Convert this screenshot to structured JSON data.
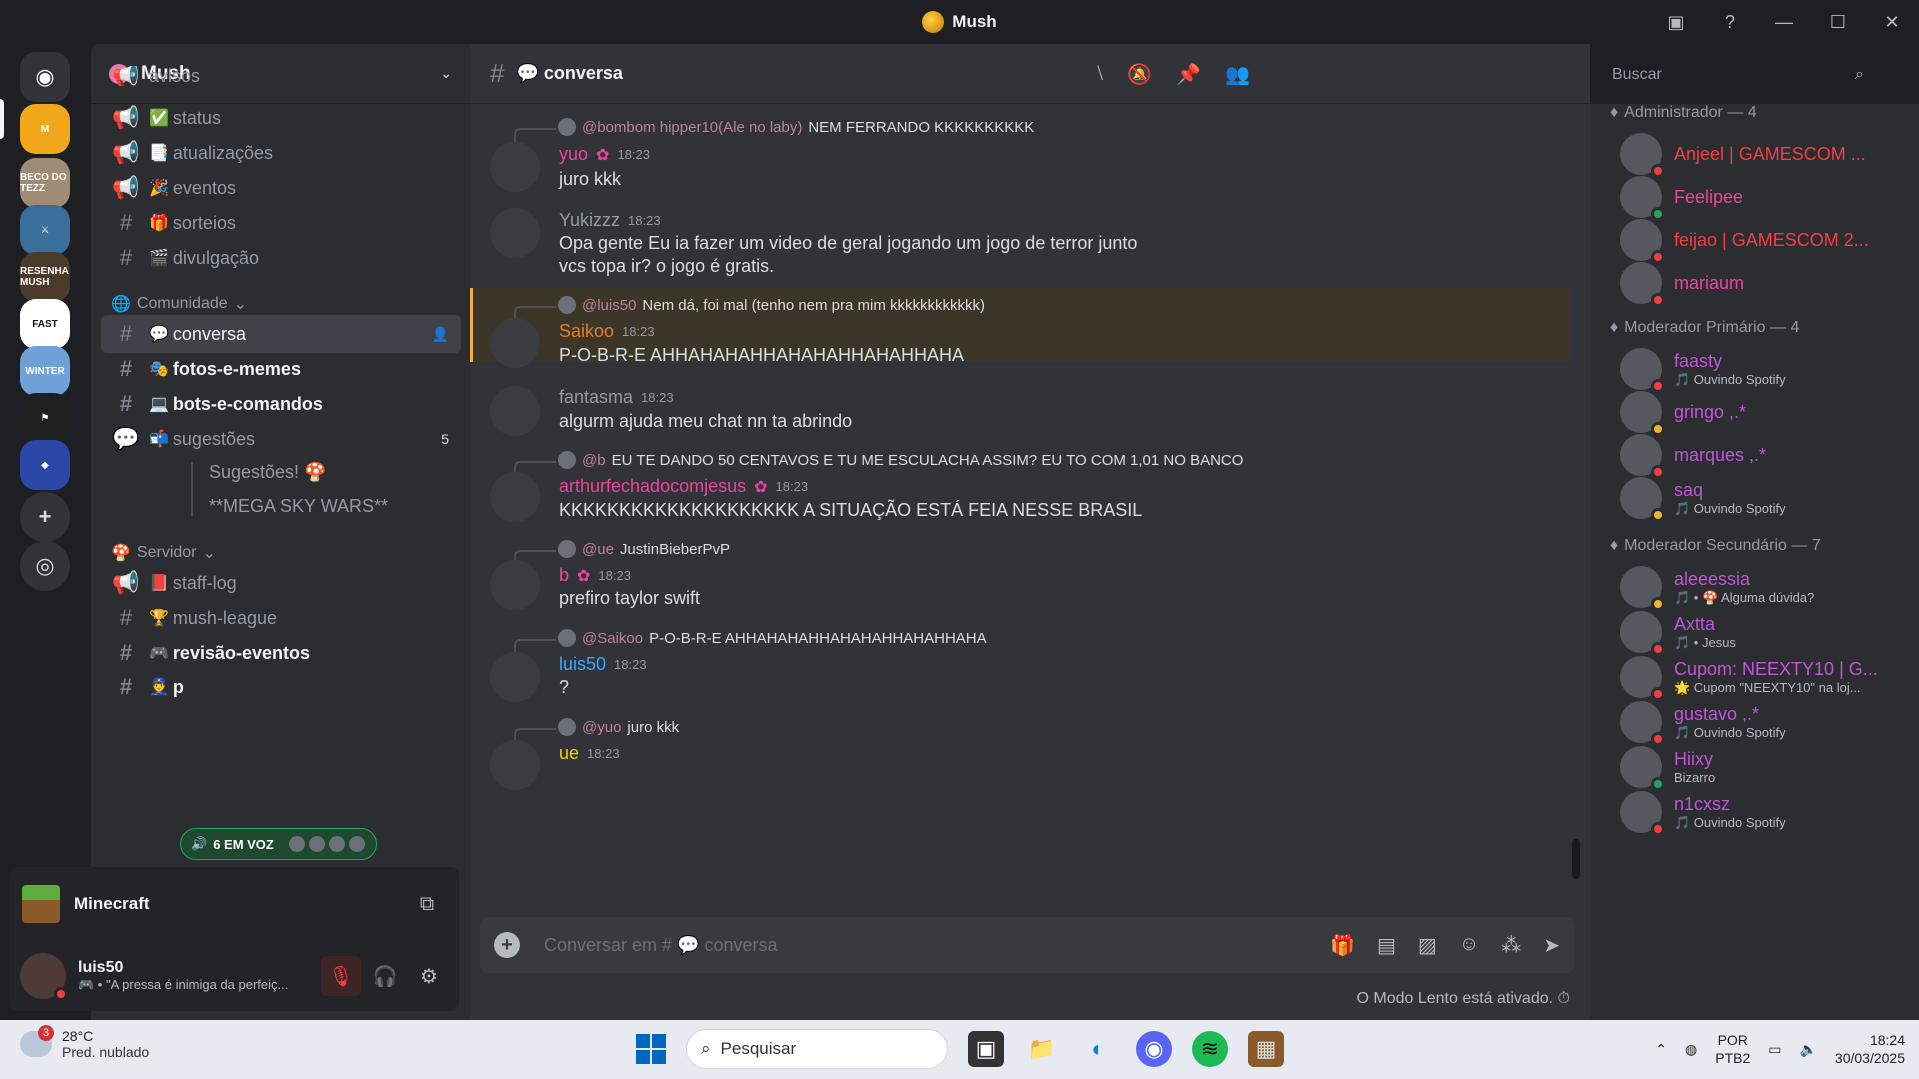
{
  "window": {
    "title": "Mush"
  },
  "rail": {
    "servers": [
      {
        "label": "M",
        "color": "#f0a81a"
      },
      {
        "label": "BECO DO TEZZ",
        "color": "#a08c74"
      },
      {
        "label": "⚔",
        "color": "#3a6f9c"
      },
      {
        "label": "RESENHA MUSH",
        "color": "#4a3b2a"
      },
      {
        "label": "FAST",
        "color": "#ffffff"
      },
      {
        "label": "WINTER",
        "color": "#6fa0d8"
      },
      {
        "label": "⚑",
        "color": "#1f1f1f"
      },
      {
        "label": "◆",
        "color": "#2b47a8"
      }
    ]
  },
  "guild": {
    "name": "Mush"
  },
  "channels": {
    "top_partial": "avisos",
    "items": [
      {
        "emoji": "✅",
        "label": "status"
      },
      {
        "emoji": "📑",
        "label": "atualizações"
      },
      {
        "emoji": "🎉",
        "label": "eventos"
      },
      {
        "emoji": "🎁",
        "label": "sorteios"
      },
      {
        "emoji": "🎬",
        "label": "divulgação"
      }
    ],
    "cat_comunidade": "Comunidade",
    "comunidade": [
      {
        "emoji": "💬",
        "label": "conversa"
      },
      {
        "emoji": "🎭",
        "label": "fotos-e-memes"
      },
      {
        "emoji": "💻",
        "label": "bots-e-comandos"
      },
      {
        "emoji": "📬",
        "label": "sugestões",
        "count": "5"
      }
    ],
    "threads": [
      "Sugestões! 🍄",
      "**MEGA SKY WARS**"
    ],
    "cat_servidor": "Servidor",
    "servidor": [
      {
        "emoji": "📕",
        "label": "staff-log"
      },
      {
        "emoji": "🏆",
        "label": "mush-league"
      },
      {
        "emoji": "🎮",
        "label": "revisão-eventos"
      },
      {
        "emoji": "👮",
        "label": "p"
      }
    ],
    "voice_badge": "6 EM VOZ"
  },
  "activity": {
    "label": "Minecraft"
  },
  "user": {
    "name": "luis50",
    "status": "🎮 • \"A pressa é inimiga da perfeiç..."
  },
  "chat": {
    "channel": "💬 conversa",
    "search_placeholder": "Buscar",
    "messages": [
      {
        "reply_mention": "@bombom hipper10(Ale no laby)",
        "reply_text": "NEM FERRANDO KKKKKKKKKK",
        "user": "yuo",
        "color": "#eb459e",
        "badge": true,
        "time": "18:23",
        "text": "juro kkk"
      },
      {
        "user": "Yukizzz",
        "color": "#949ba4",
        "time": "18:23",
        "text": "Opa gente Eu ia fazer um video de geral jogando um jogo de terror junto\nvcs topa ir? o jogo é gratis."
      },
      {
        "reply_mention": "@luis50",
        "reply_text": "Nem dá, foi mal (tenho nem pra mim kkkkkkkkkkkk)",
        "user": "Saikoo",
        "color": "#e67e22",
        "time": "18:23",
        "text": "P-O-B-R-E AHHAHAHAHHAHAHAHHAHAHHAHA"
      },
      {
        "user": "fantasma",
        "color": "#949ba4",
        "time": "18:23",
        "text": "algurm ajuda meu chat nn ta abrindo"
      },
      {
        "reply_mention": "@b",
        "reply_text": "EU TE DANDO 50 CENTAVOS E TU ME ESCULACHA ASSIM? EU TO COM 1,01 NO BANCO",
        "user": "arthurfechadocomjesus",
        "color": "#eb459e",
        "badge": true,
        "time": "18:23",
        "text": "KKKKKKKKKKKKKKKKKKKK A SITUAÇÃO ESTÁ FEIA NESSE BRASIL"
      },
      {
        "reply_mention": "@ue",
        "reply_text": "JustinBieberPvP",
        "user": "b",
        "color": "#eb459e",
        "badge": true,
        "time": "18:23",
        "text": "prefiro taylor swift"
      },
      {
        "reply_mention": "@Saikoo",
        "reply_text": "P-O-B-R-E AHHAHAHAHHAHAHAHHAHAHHAHA",
        "user": "luis50",
        "color": "#3ea6ff",
        "time": "18:23",
        "text": "?"
      },
      {
        "reply_mention": "@yuo",
        "reply_text": "juro kkk",
        "user": "ue",
        "color": "#f0d000",
        "time": "18:23",
        "text": ""
      }
    ],
    "composer_placeholder": "Conversar em # 💬 conversa",
    "slow_mode": "O Modo Lento está ativado."
  },
  "members": {
    "roles": [
      {
        "label": "Administrador — 4",
        "members": [
          {
            "name": "Anjeel | GAMESCOM ...",
            "color": "#f23f43",
            "sub": "",
            "status": "#f23f43"
          },
          {
            "name": "Feelipee",
            "color": "#eb459e",
            "sub": "",
            "status": "#23a55a"
          },
          {
            "name": "feijao | GAMESCOM 2...",
            "color": "#f23f43",
            "sub": "",
            "status": "#f23f43"
          },
          {
            "name": "mariaum",
            "color": "#eb459e",
            "sub": "",
            "status": "#f23f43"
          }
        ]
      },
      {
        "label": "Moderador Primário — 4",
        "members": [
          {
            "name": "faasty",
            "color": "#c155d6",
            "sub": "🎵 Ouvindo Spotify",
            "status": "#f23f43"
          },
          {
            "name": "gringo ,.*",
            "color": "#c155d6",
            "sub": "",
            "status": "#f0b232"
          },
          {
            "name": "marques ,.*",
            "color": "#c155d6",
            "sub": "",
            "status": "#f23f43"
          },
          {
            "name": "saq",
            "color": "#c155d6",
            "sub": "🎵 Ouvindo Spotify",
            "status": "#f0b232"
          }
        ]
      },
      {
        "label": "Moderador Secundário — 7",
        "members": [
          {
            "name": "aleeessia",
            "color": "#c155d6",
            "sub": "🎵 • 🍄 Alguma dúvida?",
            "status": "#f0b232"
          },
          {
            "name": "Axtta",
            "color": "#c155d6",
            "sub": "🎵 • Jesus",
            "status": "#f23f43"
          },
          {
            "name": "Cupom: NEEXTY10 | G...",
            "color": "#c155d6",
            "sub": "🌟 Cupom \"NEEXTY10\" na loj...",
            "status": "#f23f43"
          },
          {
            "name": "gustavo ,.*",
            "color": "#c155d6",
            "sub": "🎵 Ouvindo Spotify",
            "status": "#f23f43"
          },
          {
            "name": "Hiixy",
            "color": "#c155d6",
            "sub": "Bizarro",
            "status": "#23a55a"
          },
          {
            "name": "n1cxsz",
            "color": "#c155d6",
            "sub": "🎵 Ouvindo Spotify",
            "status": "#f23f43"
          }
        ]
      }
    ]
  },
  "taskbar": {
    "weather_temp": "28°C",
    "weather_desc": "Pred. nublado",
    "weather_count": "3",
    "search": "Pesquisar",
    "lang1": "POR",
    "lang2": "PTB2",
    "time": "18:24",
    "date": "30/03/2025"
  }
}
